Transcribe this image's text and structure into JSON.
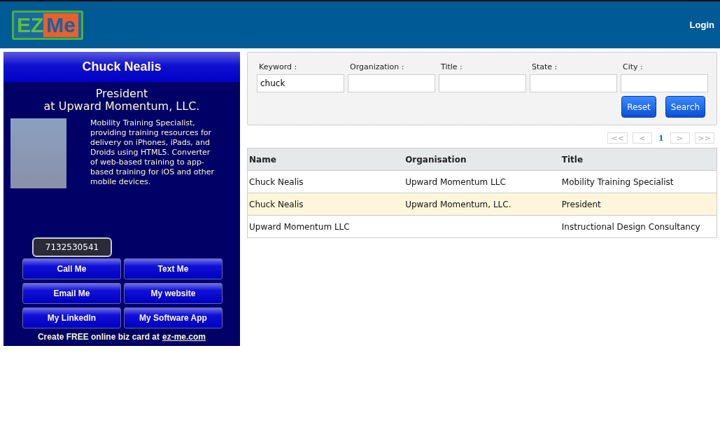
{
  "header": {
    "logo": {
      "left": "EZ",
      "right": "Me"
    },
    "login": "Login"
  },
  "card": {
    "name": "Chuck Nealis",
    "role": "President",
    "company": "at Upward Momentum, LLC.",
    "bio": "Mobility Training Specialist, providing training resources for delivery on iPhones, iPads, and Droids using HTML5. Converter of web-based training to app-based training for iOS and other mobile devices.",
    "phone": "7132530541",
    "buttons": [
      "Call Me",
      "Text Me",
      "Email Me",
      "My website",
      "My LinkedIn",
      "My Software App"
    ],
    "footer": "Create FREE online biz card at",
    "footer_link": "ez-me.com"
  },
  "search": {
    "fields": [
      {
        "label": "Keyword :",
        "value": "chuck"
      },
      {
        "label": "Organization :"
      },
      {
        "label": "Title :"
      },
      {
        "label": "State :"
      },
      {
        "label": "City :"
      }
    ],
    "buttons": [
      "Reset",
      "Search"
    ]
  },
  "pagination": [
    {
      "label": "<<",
      "kind": "nav"
    },
    {
      "label": "<",
      "kind": "nav"
    },
    {
      "label": "1",
      "kind": "page",
      "selected": true
    },
    {
      "label": ">",
      "kind": "nav"
    },
    {
      "label": ">>",
      "kind": "nav"
    }
  ],
  "table": {
    "columns": [
      "Name",
      "Organisation",
      "Title"
    ],
    "rows": [
      {
        "cells": [
          "Chuck Nealis",
          "Upward Momentum LLC",
          "Mobility Training Specialist"
        ],
        "selected": false
      },
      {
        "cells": [
          "Chuck Nealis",
          "Upward Momentum, LLC.",
          "President"
        ],
        "selected": true
      },
      {
        "cells": [
          "Upward Momentum LLC",
          null,
          "Instructional Design Consultancy"
        ],
        "selected": false
      }
    ]
  }
}
